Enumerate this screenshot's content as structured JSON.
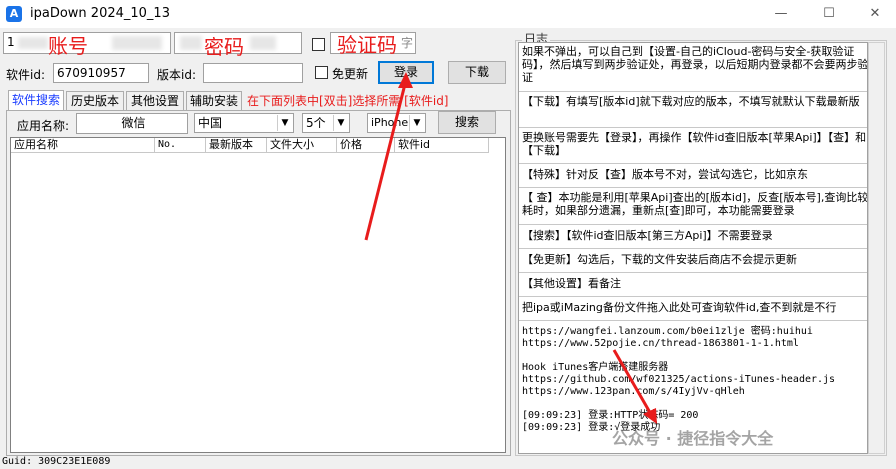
{
  "window": {
    "title": "ipaDown 2024_10_13",
    "controls": {
      "minimize": "—",
      "maximize": "☐",
      "close": "✕"
    }
  },
  "login": {
    "account_prefix": "1",
    "account_label": "账号",
    "password_label": "密码",
    "verify_label": "验证码",
    "verify_field_text": "字"
  },
  "row2": {
    "appid_label": "软件id:",
    "appid_value": "670910957",
    "version_label": "版本id:",
    "version_value": "",
    "no_update_label": "免更新",
    "login_button": "登录",
    "download_button": "下载"
  },
  "tabs": [
    "软件搜索",
    "历史版本",
    "其他设置",
    "辅助安装"
  ],
  "hint": "在下面列表中[双击]选择所需 [软件id]",
  "search": {
    "app_name_label": "应用名称:",
    "app_name_value": "微信",
    "country_value": "中国",
    "count_value": "5个",
    "device_value": "iPhone",
    "search_button": "搜索"
  },
  "table": {
    "columns": [
      "应用名称",
      "No.",
      "最新版本",
      "文件大小",
      "价格",
      "软件id"
    ]
  },
  "log": {
    "title": "日志",
    "entries": [
      "  如果不弹出，可以自己到【设置-自己的iCloud-密码与安全-获取验证码】，然后填写到两步验证处，再登录，以后短期内登录都不会要两步验证",
      "【下载】有填写[版本id]就下载对应的版本，不填写就默认下载最新版",
      "更换账号需要先【登录】，再操作【软件id查旧版本[苹果Api]】【查】和【下载】",
      "【特殊】针对反【查】版本号不对，尝试勾选它，比如京东",
      "【 查】本功能是利用[苹果Api]查出的[版本id]，反查[版本号],查询比较耗时，如果部分遗漏，重新点[查]即可，本功能需要登录",
      "【搜索】【软件id查旧版本[第三方Api]】不需要登录",
      "【免更新】勾选后，下载的文件安装后商店不会提示更新",
      "【其他设置】看备注",
      "把ipa或iMazing备份文件拖入此处可查询软件id,查不到就是不行"
    ],
    "links": [
      "https://wangfei.lanzoum.com/b0ei1zlje 密码:huihui",
      "https://www.52pojie.cn/thread-1863801-1-1.html",
      "",
      "Hook iTunes客户端搭建服务器",
      "https://github.com/wf021325/actions-iTunes-header.js",
      "https://www.123pan.com/s/4IyjVv-qHleh",
      "",
      "[09:09:23] 登录:HTTP状态码= 200",
      "[09:09:23] 登录:√登录成功"
    ]
  },
  "watermark": "公众号 · 捷径指令大全",
  "status": "Guid: 309C23E1E089"
}
